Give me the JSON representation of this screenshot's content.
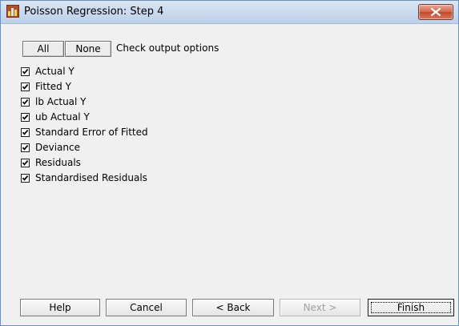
{
  "window": {
    "title": "Poisson Regression: Step 4",
    "app_icon": "app-icon",
    "close_icon": "close-icon"
  },
  "toolbar": {
    "all_label": "All",
    "none_label": "None",
    "hint": "Check output options"
  },
  "options": [
    {
      "label": "Actual Y",
      "checked": true
    },
    {
      "label": "Fitted Y",
      "checked": true
    },
    {
      "label": "lb Actual Y",
      "checked": true
    },
    {
      "label": "ub Actual Y",
      "checked": true
    },
    {
      "label": "Standard Error of Fitted",
      "checked": true
    },
    {
      "label": "Deviance",
      "checked": true
    },
    {
      "label": "Residuals",
      "checked": true
    },
    {
      "label": "Standardised Residuals",
      "checked": true
    }
  ],
  "buttons": {
    "help": "Help",
    "cancel": "Cancel",
    "back": "< Back",
    "next": "Next >",
    "finish": "Finish"
  },
  "colors": {
    "close_red": "#c04a2d",
    "titlebar": "#c9d9ee",
    "dialog_bg": "#f0f0f0"
  }
}
